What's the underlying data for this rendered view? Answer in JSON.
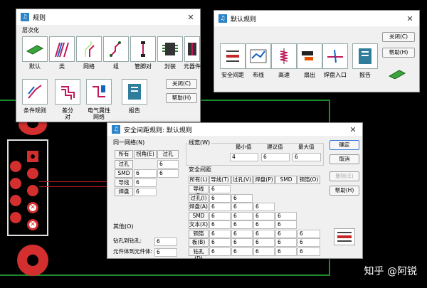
{
  "rules_window": {
    "title": "规则",
    "group_label": "层次化",
    "tools": [
      {
        "label": "默认",
        "icon": "pcb-board-icon"
      },
      {
        "label": "类",
        "icon": "net-class-icon"
      },
      {
        "label": "网络",
        "icon": "net-icon"
      },
      {
        "label": "组",
        "icon": "group-icon"
      },
      {
        "label": "管脚对",
        "icon": "pin-pair-icon"
      },
      {
        "label": "封装",
        "icon": "package-icon"
      },
      {
        "label": "元器件",
        "icon": "component-icon"
      }
    ],
    "tools_row2": [
      {
        "label": "条件规则",
        "icon": "conditional-rule-icon"
      },
      {
        "label": "差分\n对",
        "icon": "diff-pair-icon"
      },
      {
        "label": "电气属性\n网络",
        "icon": "electrical-net-icon"
      },
      {
        "label": "报告",
        "icon": "report-icon"
      }
    ],
    "close_label": "关闭(C)",
    "help_label": "帮助(H)"
  },
  "default_rules_window": {
    "title": "默认规则",
    "tools": [
      {
        "label": "安全间距",
        "icon": "clearance-icon"
      },
      {
        "label": "布线",
        "icon": "routing-icon"
      },
      {
        "label": "高速",
        "icon": "high-speed-icon"
      },
      {
        "label": "扇出",
        "icon": "fanout-icon"
      },
      {
        "label": "焊盘入口",
        "icon": "pad-entry-icon"
      },
      {
        "label": "报告",
        "icon": "report-icon"
      }
    ],
    "close_label": "关闭(C)",
    "help_label": "帮助(H)"
  },
  "clearance_window": {
    "title": "安全间距规则: 默认规则",
    "same_net": {
      "legend": "同一网络(N)",
      "btn_all": "所有",
      "btn_corner": "拐角(E)",
      "btn_via": "过孔",
      "rows": [
        {
          "label": "过孔",
          "values": [
            "",
            "6"
          ]
        },
        {
          "label": "SMD",
          "values": [
            "6",
            "6"
          ]
        },
        {
          "label": "导线",
          "values": [
            "6",
            ""
          ]
        },
        {
          "label": "焊盘",
          "values": [
            "6",
            ""
          ]
        }
      ]
    },
    "trace_width": {
      "legend": "线宽(W)",
      "min_label": "最小值",
      "rec_label": "建议值",
      "max_label": "最大值",
      "min": "4",
      "rec": "6",
      "max": "6"
    },
    "clearance": {
      "legend": "安全间距",
      "btn_all": "所有(L)",
      "headers": [
        "导线(T)",
        "过孔(V)",
        "焊盘(P)",
        "SMD",
        "铜箔(O)"
      ],
      "rows": [
        {
          "label": "导线(R)",
          "values": [
            "6"
          ]
        },
        {
          "label": "过孔(I)",
          "values": [
            "6",
            "6"
          ]
        },
        {
          "label": "焊盘(A)",
          "values": [
            "6",
            "6",
            "6"
          ]
        },
        {
          "label": "SMD",
          "values": [
            "6",
            "6",
            "6",
            "6"
          ]
        },
        {
          "label": "文本(X)",
          "values": [
            "6",
            "6",
            "6",
            "6"
          ]
        },
        {
          "label": "铜箔(C)",
          "values": [
            "6",
            "6",
            "6",
            "6",
            "6"
          ]
        },
        {
          "label": "板(B)",
          "values": [
            "6",
            "6",
            "6",
            "6",
            "6"
          ]
        },
        {
          "label": "钻孔(D)",
          "values": [
            "6",
            "6",
            "6",
            "6",
            "6"
          ]
        }
      ]
    },
    "other": {
      "legend": "其他(O)",
      "drill_label": "钻孔到钻孔:",
      "drill_value": "6",
      "comp_label": "元件体到元件体:",
      "comp_value": "6"
    },
    "ok_label": "确定",
    "cancel_label": "取消",
    "delete_label": "删除(E)",
    "help_label": "帮助(H)"
  },
  "watermark": "知乎 @阿锐",
  "colors": {
    "pcb_green": "#1d8d2c",
    "pad_red": "#d32f2f",
    "accent": "#2c84c7"
  }
}
